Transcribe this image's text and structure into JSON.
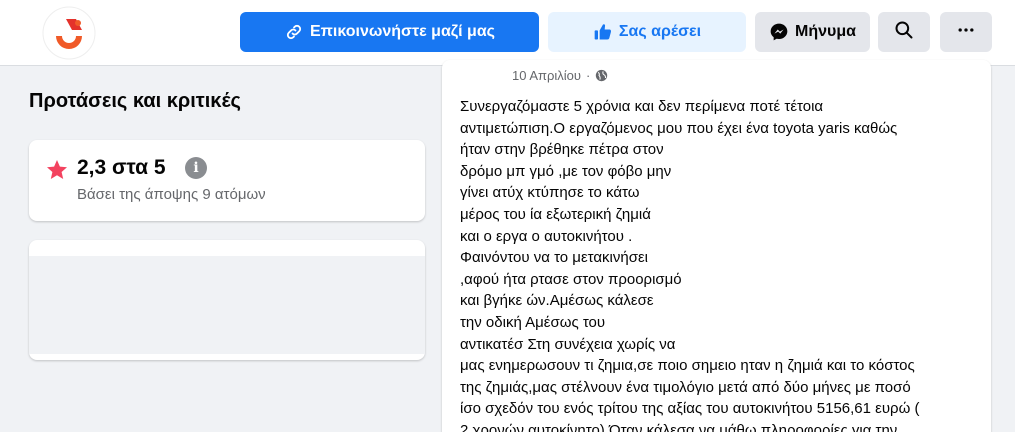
{
  "header": {
    "contact_button": "Επικοινωνήστε μαζί μας",
    "like_button": "Σας αρέσει",
    "message_button": "Μήνυμα",
    "search_icon": "search-icon",
    "more_icon": "more-icon"
  },
  "reviews": {
    "section_title": "Προτάσεις και κριτικές",
    "rating_value": "2,3 στα 5",
    "rating_subtitle": "Βάσει της άποψης 9 ατόμων",
    "star_color": "#f3425f"
  },
  "post": {
    "date": "10 Απριλίου",
    "dot": "·",
    "text": "Συνεργαζόμαστε 5 χρόνια και δεν περίμενα ποτέ τέτοια\nαντιμετώπιση.Ο εργαζόμενος μου που έχει ένα toyota yaris καθώς\nήταν στην                                                            βρέθηκε πέτρα στον\nδρόμο μπ                                                            γμό ,με τον φόβο μην\nγίνει ατύχ                                                           κτύπησε το κάτω\nμέρος του                                                           ία εξωτερική ζημιά\nκαι ο εργα                                                           ο αυτοκινήτου .\nΦαινόντου                                                           να το μετακινήσει\n,αφού ήτα                                                            ρτασε στον προορισμό\nκαι βγήκε                                                            ών.Αμέσως κάλεσε\nτην οδική                                                            Αμέσως του\nαντικατέσ                                                           Στη συνέχεια χωρίς να\nμας ενημερωσουν τι ζημια,σε ποιο σημειο ηταν η ζημιά και το κόστος\nτης ζημιάς,μας στέλνουν ένα τιμολόγιο μετά από δύο μήνες με ποσό\nίσο σχεδόν του ενός τρίτου της αξίας του αυτοκινήτου 5156,61 ευρώ (\n2 χρονών αυτοκίνητο).Όταν κάλεσα να μάθω πληροφορίες για την"
  }
}
